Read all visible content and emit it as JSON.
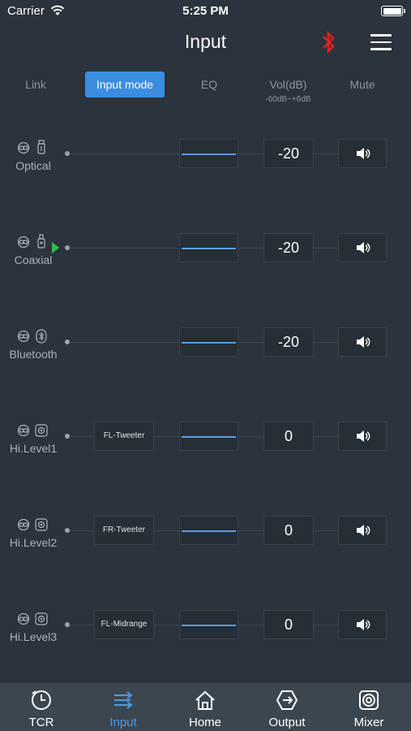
{
  "status_bar": {
    "carrier": "Carrier",
    "time": "5:25 PM"
  },
  "header": {
    "title": "Input"
  },
  "colors": {
    "accent": "#3b8de0",
    "bluetooth": "#e0201e",
    "active_marker": "#22c44b",
    "eq_line": "#5b9de0"
  },
  "tabs": [
    {
      "label": "Link"
    },
    {
      "label": "Input mode",
      "active": true
    },
    {
      "label": "EQ"
    },
    {
      "label": "Vol(dB)",
      "sub": "-60dB~+6dB"
    },
    {
      "label": "Mute"
    }
  ],
  "rows": [
    {
      "label": "Optical",
      "icon": "optical-icon",
      "mode": "",
      "volume": "-20"
    },
    {
      "label": "Coaxial",
      "icon": "coaxial-icon",
      "mode": "",
      "volume": "-20",
      "active": true
    },
    {
      "label": "Bluetooth",
      "icon": "bluetooth-icon",
      "mode": "",
      "volume": "-20"
    },
    {
      "label": "Hi.Level1",
      "icon": "hi-level-icon",
      "mode": "FL-Tweeter",
      "volume": "0"
    },
    {
      "label": "Hi.Level2",
      "icon": "hi-level-icon",
      "mode": "FR-Tweeter",
      "volume": "0"
    },
    {
      "label": "Hi.Level3",
      "icon": "hi-level-icon",
      "mode": "FL-Midrange",
      "volume": "0"
    }
  ],
  "bottom_nav": [
    {
      "label": "TCR",
      "icon": "clock-icon"
    },
    {
      "label": "Input",
      "icon": "input-icon",
      "active": true
    },
    {
      "label": "Home",
      "icon": "home-icon"
    },
    {
      "label": "Output",
      "icon": "output-icon"
    },
    {
      "label": "Mixer",
      "icon": "mixer-icon"
    }
  ]
}
